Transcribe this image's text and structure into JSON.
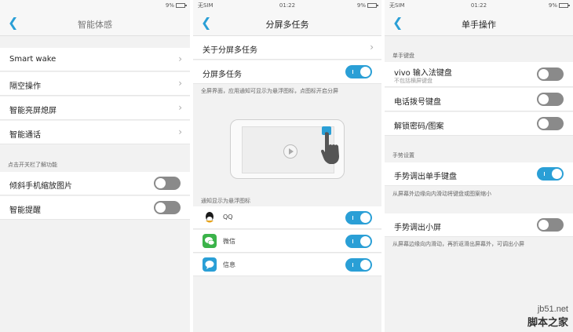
{
  "panel1": {
    "status": {
      "time": "",
      "battery": "9%"
    },
    "title": "智能体感",
    "items": [
      {
        "label": "Smart wake"
      },
      {
        "label": "隔空操作"
      },
      {
        "label": "智能亮屏熄屏"
      },
      {
        "label": "智能通话"
      }
    ],
    "section": "点击开关栏了解功能",
    "toggles": [
      {
        "label": "倾斜手机缩放图片",
        "state": "off"
      },
      {
        "label": "智能提醒",
        "state": "off"
      }
    ]
  },
  "panel2": {
    "status": {
      "sim": "无SIM",
      "time": "01:22",
      "battery": "9%"
    },
    "title": "分屏多任务",
    "about_label": "关于分屏多任务",
    "toggle_label": "分屏多任务",
    "toggle_state": "on",
    "description": "全屏界面，应用通知可显示为悬浮图标，点图标开启分屏",
    "section": "通知显示为悬浮图标",
    "apps": [
      {
        "label": "QQ",
        "icon": "qq-icon",
        "color": "#1a1a1a",
        "state": "on"
      },
      {
        "label": "微信",
        "icon": "wechat-icon",
        "color": "#3bb34a",
        "state": "on"
      },
      {
        "label": "信息",
        "icon": "message-icon",
        "color": "#2a9fd6",
        "state": "on"
      }
    ]
  },
  "panel3": {
    "status": {
      "sim": "无SIM",
      "time": "01:22",
      "battery": "9%"
    },
    "title": "单手操作",
    "section1": "单手键盘",
    "keyboard_items": [
      {
        "label": "vivo 输入法键盘",
        "sub": "不包括横屏键盘",
        "state": "off"
      },
      {
        "label": "电话拨号键盘",
        "state": "off"
      },
      {
        "label": "解锁密码/图案",
        "state": "off"
      }
    ],
    "section2": "手势设置",
    "gesture_keyboard": {
      "label": "手势调出单手键盘",
      "state": "on",
      "note": "从屏幕外边缘向内滑动将键盘或图案缩小"
    },
    "gesture_small": {
      "label": "手势调出小屏",
      "state": "off",
      "note": "从屏幕边缘向内滑动，再折返滑出屏幕外，可调出小屏"
    }
  },
  "watermark": {
    "url": "jb51.net",
    "name": "脚本之家"
  },
  "colors": {
    "accent": "#2a9fd6",
    "toggle_off": "#8a8a8a"
  }
}
